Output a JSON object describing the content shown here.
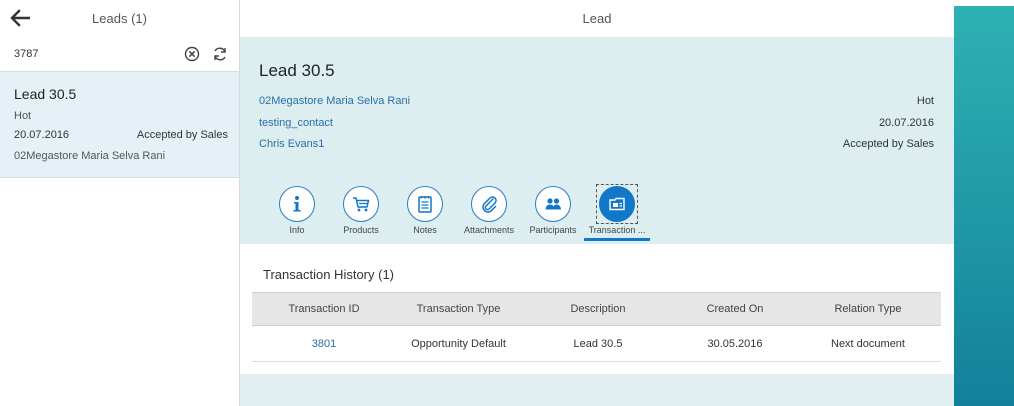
{
  "master": {
    "title": "Leads (1)",
    "search_value": "3787",
    "item": {
      "title": "Lead 30.5",
      "status": "Hot",
      "date": "20.07.2016",
      "state": "Accepted by Sales",
      "account": "02Megastore Maria Selva Rani"
    }
  },
  "detail": {
    "title": "Lead",
    "object_title": "Lead 30.5",
    "attributes_left": [
      "02Megastore Maria Selva Rani",
      "testing_contact",
      "Chris Evans1"
    ],
    "attributes_right": [
      "Hot",
      "20.07.2016",
      "Accepted by Sales"
    ],
    "tabs": [
      {
        "label": "Info",
        "icon": "info-icon"
      },
      {
        "label": "Products",
        "icon": "cart-icon"
      },
      {
        "label": "Notes",
        "icon": "notes-icon"
      },
      {
        "label": "Attachments",
        "icon": "paperclip-icon"
      },
      {
        "label": "Participants",
        "icon": "people-icon"
      },
      {
        "label": "Transaction ...",
        "icon": "transaction-icon"
      }
    ],
    "active_tab": 5,
    "section_title": "Transaction History (1)",
    "table": {
      "headers": [
        "Transaction ID",
        "Transaction Type",
        "Description",
        "Created On",
        "Relation Type"
      ],
      "rows": [
        [
          "3801",
          "Opportunity Default",
          "Lead 30.5",
          "30.05.2016",
          "Next document"
        ]
      ]
    }
  },
  "colors": {
    "accent": "#1177c9",
    "link": "#2a6fa8",
    "selected_item": "#e5f1f7",
    "header_bg": "#dceef0",
    "teal": "#2fb1b3"
  }
}
